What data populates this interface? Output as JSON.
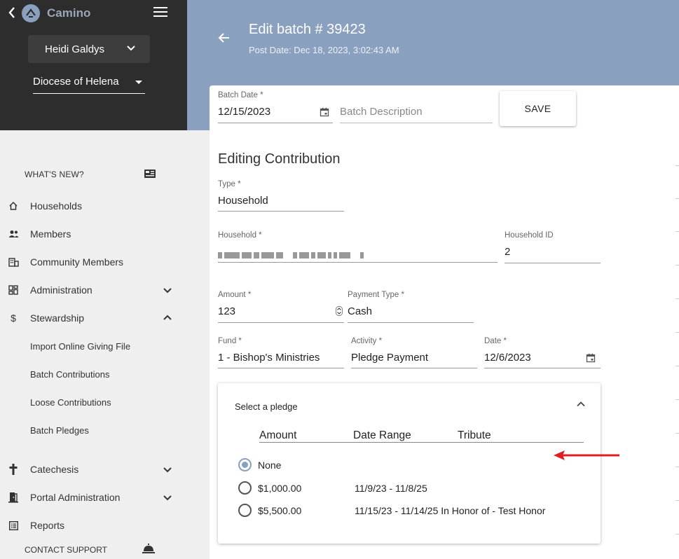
{
  "app": {
    "brand": "Camino"
  },
  "colors": {
    "sidebar_dark": "#2d2d2d",
    "header": "#8aa0bf",
    "accent": "#8aa0bf",
    "arrow": "#e02020"
  },
  "sidebar": {
    "user_name": "Heidi Galdys",
    "organization": "Diocese of Helena",
    "whats_new": "WHAT'S NEW?",
    "items": [
      {
        "label": "Households",
        "icon": "home-icon"
      },
      {
        "label": "Members",
        "icon": "people-icon"
      },
      {
        "label": "Community Members",
        "icon": "building-icon"
      },
      {
        "label": "Administration",
        "icon": "dashboard-icon"
      },
      {
        "label": "Stewardship",
        "icon": "dollar-icon"
      },
      {
        "label": "Catechesis",
        "icon": "cross-icon"
      },
      {
        "label": "Portal Administration",
        "icon": "door-icon"
      },
      {
        "label": "Reports",
        "icon": "list-icon"
      }
    ],
    "stewardship_sub": [
      "Import Online Giving File",
      "Batch Contributions",
      "Loose Contributions",
      "Batch Pledges"
    ],
    "contact_support": "CONTACT SUPPORT"
  },
  "header": {
    "title": "Edit batch # 39423",
    "post_date": "Post Date: Dec 18, 2023, 3:02:43 AM"
  },
  "batch": {
    "date_label": "Batch Date *",
    "date_value": "12/15/2023",
    "description_placeholder": "Batch Description",
    "save_label": "SAVE"
  },
  "contribution": {
    "section_title": "Editing Contribution",
    "type_label": "Type *",
    "type_value": "Household",
    "household_label": "Household *",
    "household_id_label": "Household ID",
    "household_id_value": "2",
    "amount_label": "Amount *",
    "amount_value": "123",
    "payment_type_label": "Payment Type *",
    "payment_type_value": "Cash",
    "fund_label": "Fund *",
    "fund_value": "1 - Bishop's Ministries",
    "activity_label": "Activity *",
    "activity_value": "Pledge Payment",
    "date_label": "Date *",
    "date_value": "12/6/2023"
  },
  "pledge": {
    "heading": "Select a pledge",
    "columns": [
      "Amount",
      "Date Range",
      "Tribute"
    ],
    "options": [
      {
        "amount": "None",
        "range": "",
        "tribute": "",
        "selected": true
      },
      {
        "amount": "$1,000.00",
        "range": "11/9/23 - 11/8/25",
        "tribute": "",
        "selected": false
      },
      {
        "amount": "$5,500.00",
        "range": "11/15/23 - 11/14/25 In Honor of - Test Honor",
        "tribute": "",
        "selected": false
      }
    ]
  }
}
